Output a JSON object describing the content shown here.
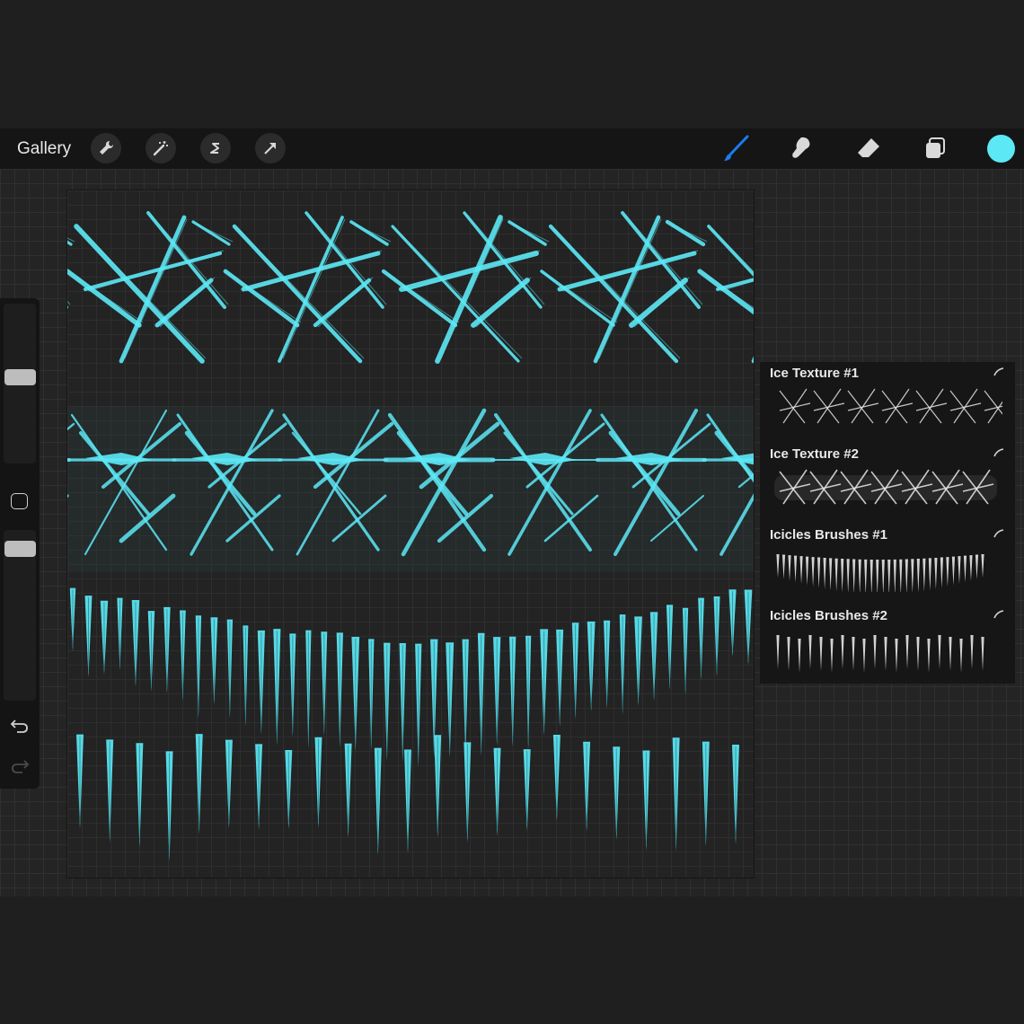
{
  "toolbar": {
    "gallery_label": "Gallery",
    "left_tools": [
      "wrench-icon",
      "magic-wand-icon",
      "selection-icon",
      "transform-arrow-icon"
    ],
    "right_tools": [
      "brush-icon",
      "smudge-icon",
      "eraser-icon",
      "layers-icon"
    ],
    "active_tool": "brush-icon",
    "current_color": "#5ce8f5"
  },
  "sidebar": {
    "brush_size_level": 0.5,
    "opacity_level": 0.5,
    "buttons": [
      "modify-icon",
      "undo-icon",
      "redo-icon"
    ]
  },
  "brush_library": {
    "items": [
      {
        "name": "Ice Texture #1",
        "preview": "ice-texture"
      },
      {
        "name": "Ice Texture #2",
        "preview": "ice-texture-dense"
      },
      {
        "name": "Icicles Brushes #1",
        "preview": "icicles-wave"
      },
      {
        "name": "Icicles Brushes #2",
        "preview": "icicles-even"
      }
    ]
  },
  "canvas": {
    "accent_color": "#5ce8f5",
    "strokes": [
      "Ice Texture #1",
      "Ice Texture #2",
      "Icicles Brushes #1",
      "Icicles Brushes #2"
    ]
  }
}
